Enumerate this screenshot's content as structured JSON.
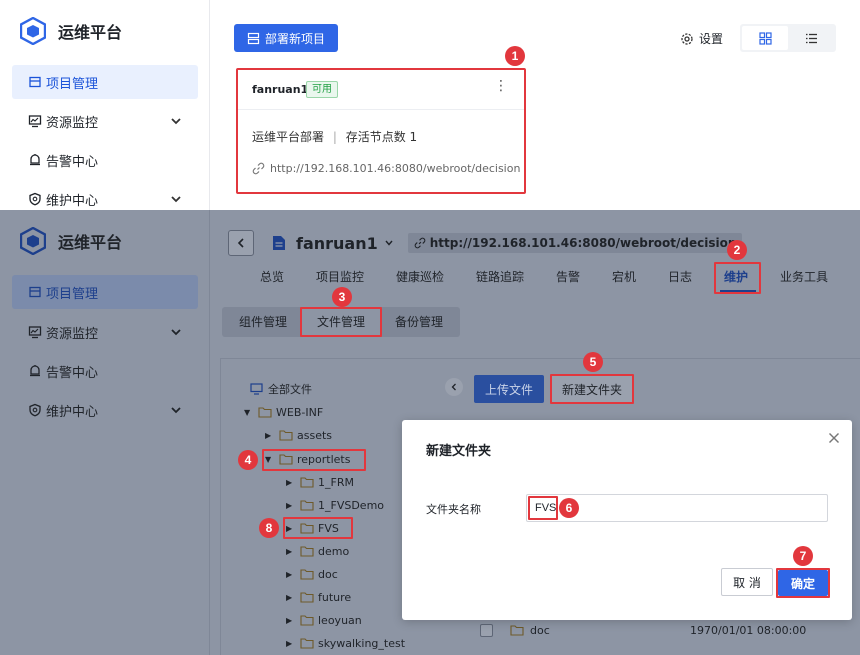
{
  "brand": {
    "name": "运维平台",
    "logo_icon": "cube-logo-icon"
  },
  "sidebar": {
    "items": [
      {
        "label": "项目管理",
        "icon": "list-icon",
        "active": true,
        "has_chevron": false
      },
      {
        "label": "资源监控",
        "icon": "monitor-icon",
        "active": false,
        "has_chevron": true
      },
      {
        "label": "告警中心",
        "icon": "bell-icon",
        "active": false,
        "has_chevron": false
      },
      {
        "label": "维护中心",
        "icon": "shield-icon",
        "active": false,
        "has_chevron": true
      }
    ]
  },
  "projects_page": {
    "deploy_button": "部署新项目",
    "settings_label": "设置",
    "card": {
      "name": "fanruan1",
      "status": "可用",
      "desc_prefix": "运维平台部署",
      "desc_sep": "|",
      "desc_suffix": "存活节点数 1",
      "url": "http://192.168.101.46:8080/webroot/decision"
    }
  },
  "project_detail": {
    "name": "fanruan1",
    "url": "http://192.168.101.46:8080/webroot/decision",
    "nav_tabs": [
      "总览",
      "项目监控",
      "健康巡检",
      "链路追踪",
      "告警",
      "宕机",
      "日志",
      "维护",
      "业务工具"
    ],
    "active_nav": "维护",
    "sub_tabs": [
      "组件管理",
      "文件管理",
      "备份管理"
    ],
    "active_sub": "文件管理",
    "tree": {
      "root": "全部文件",
      "web_inf": "WEB-INF",
      "assets": "assets",
      "reportlets": "reportlets",
      "children": [
        "1_FRM",
        "1_FVSDemo",
        "FVS",
        "demo",
        "doc",
        "future",
        "leoyuan",
        "skywalking_test"
      ]
    },
    "upload_button": "上传文件",
    "new_folder_button": "新建文件夹",
    "visible_row": {
      "name": "doc",
      "date": "1970/01/01 08:00:00"
    }
  },
  "modal": {
    "title": "新建文件夹",
    "field_label": "文件夹名称",
    "field_value": "FVS",
    "cancel": "取 消",
    "confirm": "确定"
  },
  "markers": [
    "1",
    "2",
    "3",
    "4",
    "5",
    "6",
    "7",
    "8"
  ],
  "colors": {
    "primary": "#2f66e6",
    "highlight": "#e2373d",
    "success": "#21a044"
  }
}
